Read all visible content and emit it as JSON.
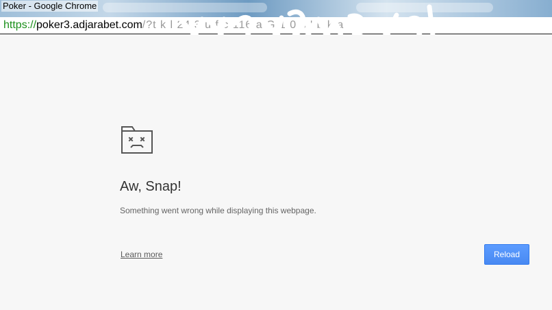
{
  "window": {
    "title": "Poker - Google Chrome"
  },
  "address_bar": {
    "scheme": "https://",
    "host": "poker3.adjarabet.com",
    "path": "/?t k  l 24 3   u  f  c 116  a  G  1  0    s  '  b    k a"
  },
  "error_page": {
    "icon": "sad-folder-icon",
    "heading": "Aw, Snap!",
    "message": "Something went wrong while displaying this webpage.",
    "learn_more_label": "Learn more",
    "reload_label": "Reload"
  },
  "colors": {
    "reload_button": "#4d90fe",
    "url_scheme": "#1a8f1a",
    "page_background": "#f7f7f7"
  }
}
